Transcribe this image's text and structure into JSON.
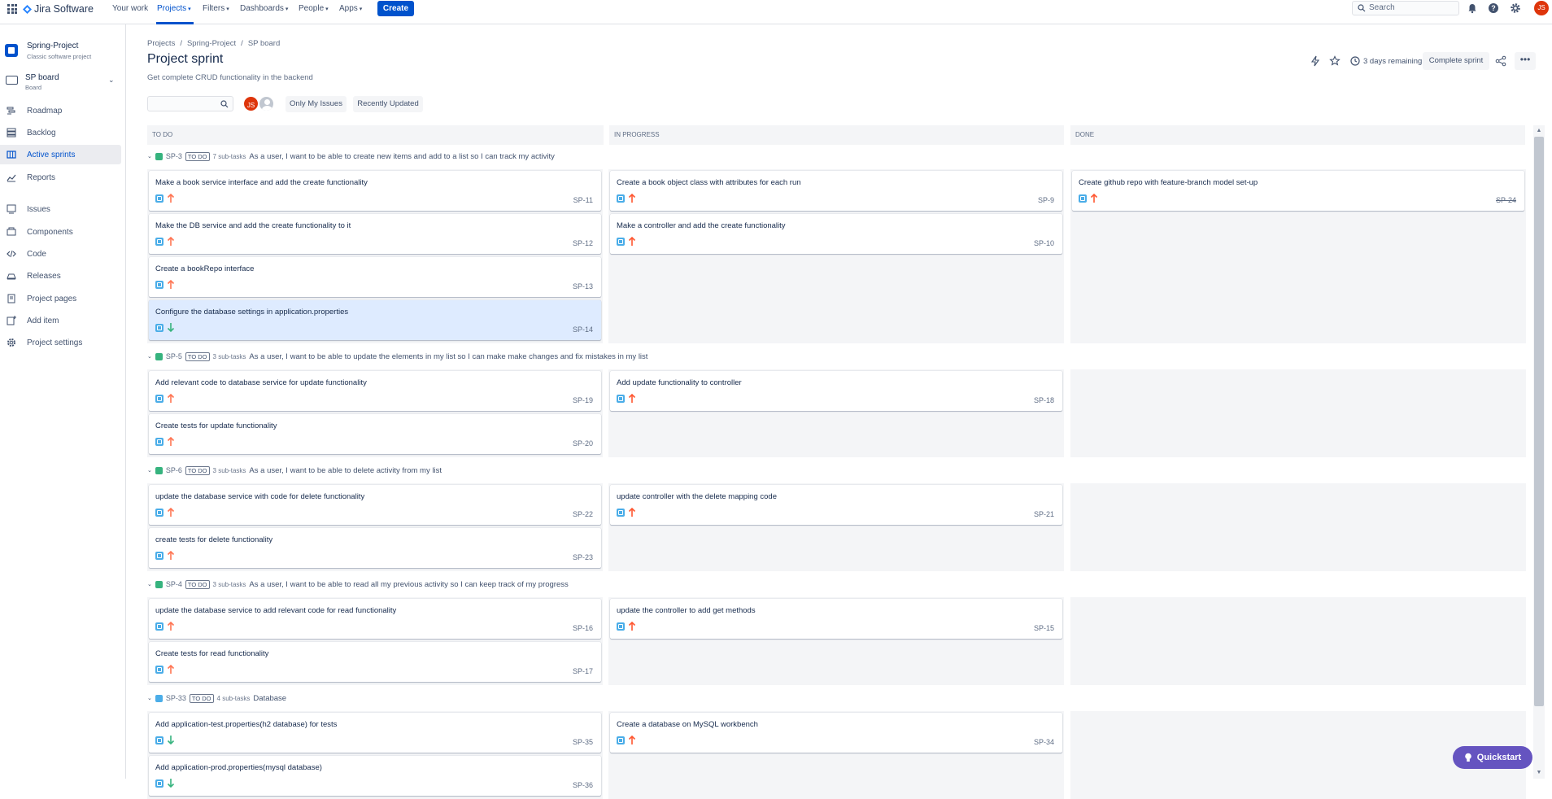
{
  "topnav": {
    "logo": "Jira Software",
    "items": [
      {
        "label": "Your work"
      },
      {
        "label": "Projects"
      },
      {
        "label": "Filters"
      },
      {
        "label": "Dashboards"
      },
      {
        "label": "People"
      },
      {
        "label": "Apps"
      }
    ],
    "create_label": "Create",
    "search_placeholder": "Search",
    "user_initials": "JS",
    "icons": [
      "notifications-icon",
      "help-icon",
      "settings-icon"
    ]
  },
  "sidebar": {
    "project_name": "Spring-Project",
    "project_type": "Classic software project",
    "board_name": "SP board",
    "board_type": "Board",
    "items": [
      {
        "label": "Roadmap",
        "icon": "roadmap-icon"
      },
      {
        "label": "Backlog",
        "icon": "backlog-icon"
      },
      {
        "label": "Active sprints",
        "icon": "board-columns-icon",
        "active": true
      },
      {
        "label": "Reports",
        "icon": "reports-icon"
      },
      {
        "label": "Issues",
        "icon": "issues-icon"
      },
      {
        "label": "Components",
        "icon": "components-icon"
      },
      {
        "label": "Code",
        "icon": "code-icon"
      },
      {
        "label": "Releases",
        "icon": "releases-icon"
      },
      {
        "label": "Project pages",
        "icon": "pages-icon"
      },
      {
        "label": "Add item",
        "icon": "add-item-icon"
      },
      {
        "label": "Project settings",
        "icon": "settings-icon"
      }
    ]
  },
  "header": {
    "breadcrumb": [
      "Projects",
      "Spring-Project",
      "SP board"
    ],
    "title": "Project sprint",
    "subtitle": "Get complete CRUD functionality in the backend",
    "days_remaining": "3 days remaining",
    "complete_sprint": "Complete sprint",
    "more": "•••"
  },
  "filters": {
    "avatar_initials": "JS",
    "only_my_issues": "Only My Issues",
    "recently_updated": "Recently Updated"
  },
  "columns": [
    "TO DO",
    "IN PROGRESS",
    "DONE"
  ],
  "swimlanes": [
    {
      "key": "SP-3",
      "status": "TO DO",
      "subtasks": "7 sub-tasks",
      "icon": "story-icon",
      "summary": "As a user, I want to be able to create new items and add to a list so I can track my activity",
      "todo": [
        {
          "title": "Make a book service interface and add the create functionality",
          "key": "SP-11",
          "priority": "high"
        },
        {
          "title": "Make the DB service and add the create functionality to it",
          "key": "SP-12",
          "priority": "high"
        },
        {
          "title": "Create a bookRepo interface",
          "key": "SP-13",
          "priority": "high"
        },
        {
          "title": "Configure the database settings in application.properties",
          "key": "SP-14",
          "priority": "low",
          "selected": true
        }
      ],
      "inprogress": [
        {
          "title": "Create a book object class with attributes for each run",
          "key": "SP-9",
          "priority": "highest"
        },
        {
          "title": "Make a controller and add the create functionality",
          "key": "SP-10",
          "priority": "highest"
        }
      ],
      "done": [
        {
          "title": "Create github repo with feature-branch model set-up",
          "key": "SP-24",
          "priority": "highest"
        }
      ]
    },
    {
      "key": "SP-5",
      "status": "TO DO",
      "subtasks": "3 sub-tasks",
      "icon": "story-icon",
      "summary": "As a user, I want to be able to update the elements in my list so I can make make changes and fix mistakes in my list",
      "todo": [
        {
          "title": "Add relevant code to database service for update functionality",
          "key": "SP-19",
          "priority": "high"
        },
        {
          "title": "Create tests for update functionality",
          "key": "SP-20",
          "priority": "high"
        }
      ],
      "inprogress": [
        {
          "title": "Add update functionality to controller",
          "key": "SP-18",
          "priority": "highest"
        }
      ],
      "done": []
    },
    {
      "key": "SP-6",
      "status": "TO DO",
      "subtasks": "3 sub-tasks",
      "icon": "story-icon",
      "summary": "As a user, I want to be able to delete activity from my list",
      "todo": [
        {
          "title": "update the database service with code for delete functionality",
          "key": "SP-22",
          "priority": "high"
        },
        {
          "title": "create tests for delete functionality",
          "key": "SP-23",
          "priority": "high"
        }
      ],
      "inprogress": [
        {
          "title": "update controller with the delete mapping code",
          "key": "SP-21",
          "priority": "highest"
        }
      ],
      "done": []
    },
    {
      "key": "SP-4",
      "status": "TO DO",
      "subtasks": "3 sub-tasks",
      "icon": "story-icon",
      "summary": "As a user, I want to be able to read all my previous activity so I can keep track of my progress",
      "todo": [
        {
          "title": "update the database service to add relevant code for read functionality",
          "key": "SP-16",
          "priority": "high"
        },
        {
          "title": "Create tests for read functionality",
          "key": "SP-17",
          "priority": "high"
        }
      ],
      "inprogress": [
        {
          "title": "update the controller to add get methods",
          "key": "SP-15",
          "priority": "highest"
        }
      ],
      "done": []
    },
    {
      "key": "SP-33",
      "status": "TO DO",
      "subtasks": "4 sub-tasks",
      "icon": "task-icon",
      "summary": "Database",
      "todo": [
        {
          "title": "Add application-test.properties(h2 database) for tests",
          "key": "SP-35",
          "priority": "low"
        },
        {
          "title": "Add application-prod.properties(mysql database)",
          "key": "SP-36",
          "priority": "low"
        }
      ],
      "inprogress": [
        {
          "title": "Create a database on MySQL workbench",
          "key": "SP-34",
          "priority": "highest"
        }
      ],
      "done": []
    }
  ],
  "quickstart": "Quickstart",
  "colors": {
    "brand": "#0052cc",
    "story": "#36b37e",
    "task": "#4bade8",
    "priority_high": "#ff7452",
    "priority_highest": "#ff5630",
    "priority_low": "#36b37e",
    "quickstart": "#6554c0"
  }
}
